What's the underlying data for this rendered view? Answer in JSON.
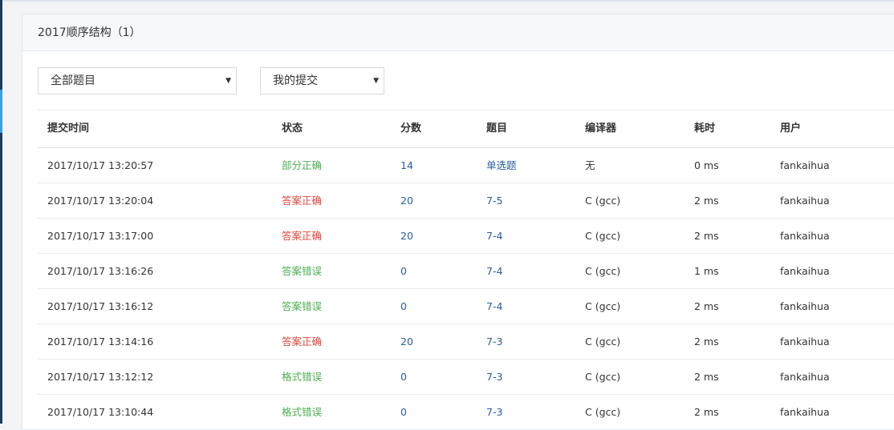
{
  "panel": {
    "title": "2017顺序结构（1）"
  },
  "filters": {
    "problem_select": "全部题目",
    "submission_select": "我的提交"
  },
  "table": {
    "headers": [
      "提交时间",
      "状态",
      "分数",
      "题目",
      "编译器",
      "耗时",
      "用户"
    ],
    "rows": [
      {
        "time": "2017/10/17 13:20:57",
        "status": "部分正确",
        "status_color": "#4caf50",
        "score": "14",
        "problem": "单选题",
        "compiler": "无",
        "duration": "0 ms",
        "user": "fankaihua"
      },
      {
        "time": "2017/10/17 13:20:04",
        "status": "答案正确",
        "status_color": "#e0463c",
        "score": "20",
        "problem": "7-5",
        "compiler": "C (gcc)",
        "duration": "2 ms",
        "user": "fankaihua"
      },
      {
        "time": "2017/10/17 13:17:00",
        "status": "答案正确",
        "status_color": "#e0463c",
        "score": "20",
        "problem": "7-4",
        "compiler": "C (gcc)",
        "duration": "2 ms",
        "user": "fankaihua"
      },
      {
        "time": "2017/10/17 13:16:26",
        "status": "答案错误",
        "status_color": "#4caf50",
        "score": "0",
        "problem": "7-4",
        "compiler": "C (gcc)",
        "duration": "1 ms",
        "user": "fankaihua"
      },
      {
        "time": "2017/10/17 13:16:12",
        "status": "答案错误",
        "status_color": "#4caf50",
        "score": "0",
        "problem": "7-4",
        "compiler": "C (gcc)",
        "duration": "2 ms",
        "user": "fankaihua"
      },
      {
        "time": "2017/10/17 13:14:16",
        "status": "答案正确",
        "status_color": "#e0463c",
        "score": "20",
        "problem": "7-3",
        "compiler": "C (gcc)",
        "duration": "2 ms",
        "user": "fankaihua"
      },
      {
        "time": "2017/10/17 13:12:12",
        "status": "格式错误",
        "status_color": "#4caf50",
        "score": "0",
        "problem": "7-3",
        "compiler": "C (gcc)",
        "duration": "2 ms",
        "user": "fankaihua"
      },
      {
        "time": "2017/10/17 13:10:44",
        "status": "格式错误",
        "status_color": "#4caf50",
        "score": "0",
        "problem": "7-3",
        "compiler": "C (gcc)",
        "duration": "2 ms",
        "user": "fankaihua"
      }
    ]
  },
  "colors": {
    "link": "#2a5d9f",
    "sidebar": "#1f3a5f",
    "sidebar_accent": "#3aa0e8"
  }
}
